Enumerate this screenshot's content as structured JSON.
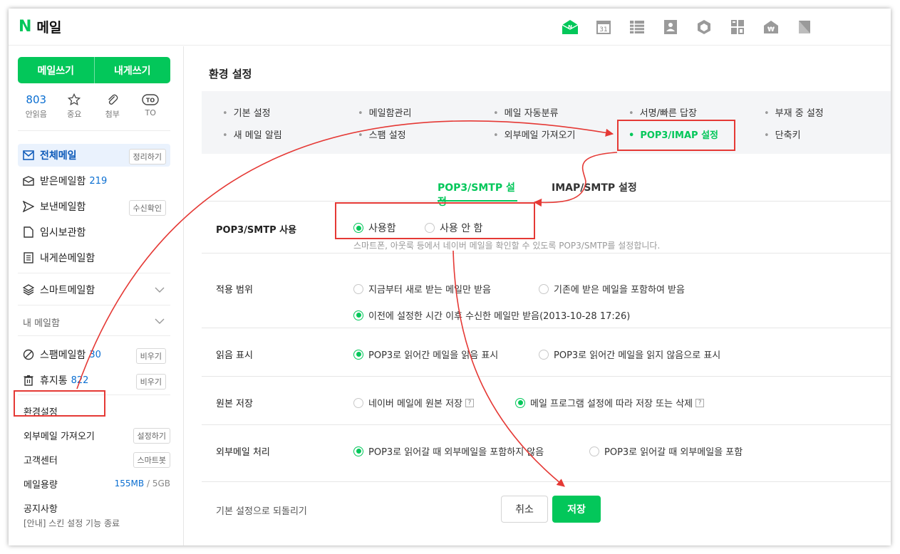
{
  "header": {
    "logo_n": "N",
    "logo_text": "메일",
    "app_icons": [
      "mail-app-icon",
      "calendar-app-icon",
      "list-app-icon",
      "contacts-app-icon",
      "box-app-icon",
      "memo-app-icon",
      "pay-app-icon",
      "bookmark-app-icon"
    ],
    "calendar_day": "31"
  },
  "sidebar": {
    "write_mail": "메일쓰기",
    "write_me": "내게쓰기",
    "quick": [
      {
        "top": "803",
        "label": "안읽음"
      },
      {
        "top": "☆",
        "label": "중요"
      },
      {
        "top": "",
        "label": "첨부"
      },
      {
        "top": "TO",
        "label": "TO"
      }
    ],
    "all_mail": "전체메일",
    "all_mail_btn": "정리하기",
    "inbox": "받은메일함",
    "inbox_count": "219",
    "sent": "보낸메일함",
    "sent_btn": "수신확인",
    "drafts": "임시보관함",
    "to_me": "내게쓴메일함",
    "smart": "스마트메일함",
    "my_boxes": "내 메일함",
    "spam": "스팸메일함",
    "spam_count": "30",
    "spam_btn": "비우기",
    "trash": "휴지통",
    "trash_count": "822",
    "trash_btn": "비우기",
    "settings": "환경설정",
    "external": "외부메일 가져오기",
    "external_btn": "설정하기",
    "support": "고객센터",
    "support_btn": "스마트봇",
    "storage_label": "메일용량",
    "storage_used": "155MB",
    "storage_sep": "/",
    "storage_total": "5GB",
    "notice_title": "공지사항",
    "notice_text": "[안내] 스킨 설정 기능 종료"
  },
  "main": {
    "title": "환경 설정",
    "subnav": [
      "기본 설정",
      "메일함관리",
      "메일 자동분류",
      "서명/빠른 답장",
      "부재 중 설정",
      "새 메일 알림",
      "스팸 설정",
      "외부메일 가져오기",
      "POP3/IMAP 설정",
      "단축키"
    ],
    "tabs": [
      "POP3/SMTP 설정",
      "IMAP/SMTP 설정"
    ],
    "rows": {
      "use": {
        "label": "POP3/SMTP 사용",
        "on": "사용함",
        "off": "사용 안 함",
        "desc": "스마트폰, 아웃룩 등에서 네이버 메일을 확인할 수 있도록 POP3/SMTP를 설정합니다."
      },
      "scope": {
        "label": "적용 범위",
        "o1": "지금부터 새로 받는 메일만 받음",
        "o2": "기존에 받은 메일을 포함하여 받음",
        "o3": "이전에 설정한 시간 이후 수신한 메일만 받음(2013-10-28 17:26)"
      },
      "read": {
        "label": "읽음 표시",
        "o1": "POP3로 읽어간 메일을 읽음 표시",
        "o2": "POP3로 읽어간 메일을 읽지 않음으로 표시"
      },
      "orig": {
        "label": "원본 저장",
        "o1": "네이버 메일에 원본 저장",
        "o2": "메일 프로그램 설정에 따라 저장 또는 삭제",
        "help": "?"
      },
      "ext": {
        "label": "외부메일 처리",
        "o1": "POP3로 읽어갈 때 외부메일을 포함하지 않음",
        "o2": "POP3로 읽어갈 때 외부메일을 포함"
      }
    },
    "reset": "기본 설정으로 되돌리기",
    "cancel": "취소",
    "save": "저장"
  },
  "colors": {
    "brand": "#03c75a",
    "annotation": "#e53935",
    "link": "#0a6ed1"
  }
}
